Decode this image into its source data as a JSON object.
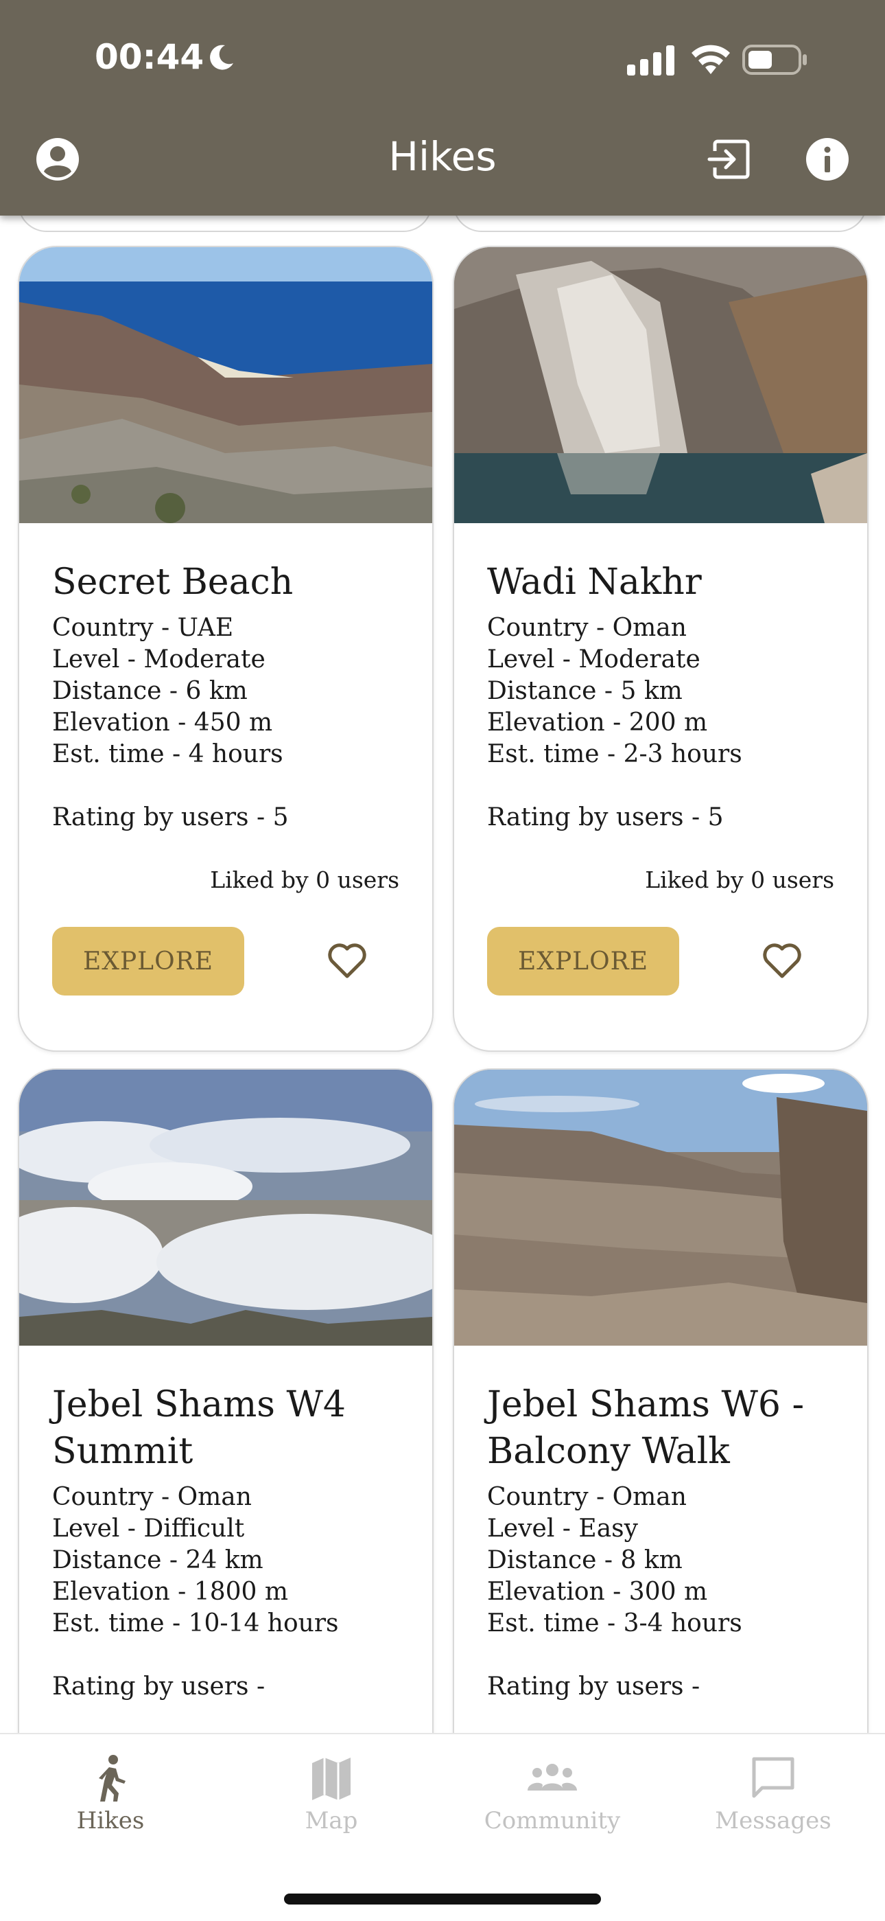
{
  "status_bar": {
    "time": "00:44"
  },
  "header": {
    "title": "Hikes"
  },
  "cards": [
    {
      "title": "Secret Beach",
      "country": "Country - UAE",
      "level": "Level - Moderate",
      "distance": "Distance - 6 km",
      "elevation": "Elevation - 450 m",
      "time": "Est. time - 4 hours",
      "rating": "Rating by users - 5",
      "liked": "Liked by 0 users",
      "explore": "EXPLORE"
    },
    {
      "title": "Wadi Nakhr",
      "country": "Country - Oman",
      "level": "Level - Moderate",
      "distance": "Distance - 5 km",
      "elevation": "Elevation - 200 m",
      "time": "Est. time - 2-3 hours",
      "rating": "Rating by users - 5",
      "liked": "Liked by 0 users",
      "explore": "EXPLORE"
    },
    {
      "title": "Jebel Shams W4 Summit",
      "country": "Country - Oman",
      "level": "Level - Difficult",
      "distance": "Distance - 24 km",
      "elevation": "Elevation - 1800 m",
      "time": "Est. time - 10-14 hours",
      "rating": "Rating by users -"
    },
    {
      "title": "Jebel Shams W6 - Balcony Walk",
      "country": "Country - Oman",
      "level": "Level - Easy",
      "distance": "Distance - 8 km",
      "elevation": "Elevation - 300 m",
      "time": "Est. time - 3-4 hours",
      "rating": "Rating by users -"
    }
  ],
  "tabs": [
    {
      "label": "Hikes",
      "icon": "hiker-icon"
    },
    {
      "label": "Map",
      "icon": "map-icon"
    },
    {
      "label": "Community",
      "icon": "people-icon"
    },
    {
      "label": "Messages",
      "icon": "message-icon"
    }
  ],
  "colors": {
    "header": "#6b6558",
    "explore": "#e1c06a",
    "inactive_tab": "#c2c2c2"
  }
}
